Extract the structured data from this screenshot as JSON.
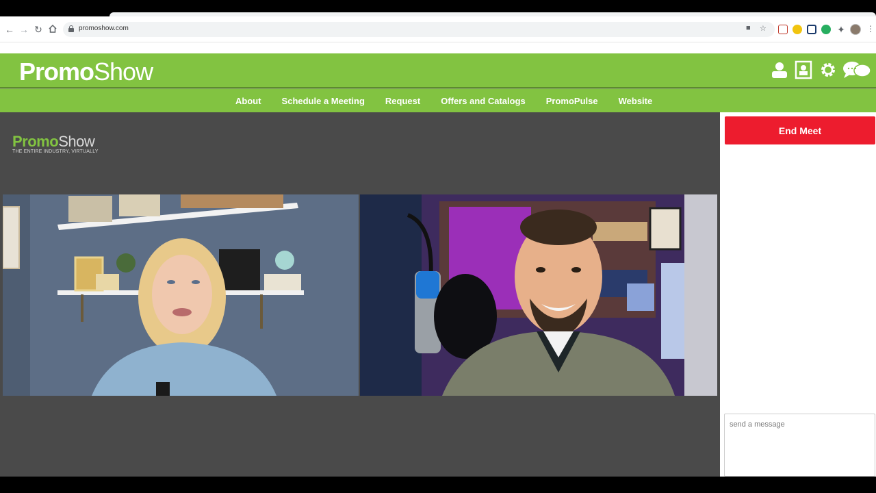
{
  "browser": {
    "url": "promoshow.com",
    "icons": [
      "back-icon",
      "forward-icon",
      "reload-icon",
      "home-icon",
      "lock-icon",
      "camera-icon",
      "star-icon",
      "puzzle-icon",
      "kebab-menu-icon"
    ]
  },
  "header": {
    "logo_bold": "Promo",
    "logo_light": "Show",
    "background": "#82c341",
    "icons": [
      "user-icon",
      "presenter-icon",
      "gear-icon",
      "chat-icon"
    ]
  },
  "nav": {
    "items": [
      {
        "label": "About"
      },
      {
        "label": "Schedule a Meeting"
      },
      {
        "label": "Request"
      },
      {
        "label": "Offers and Catalogs"
      },
      {
        "label": "PromoPulse"
      },
      {
        "label": "Website"
      }
    ]
  },
  "stage": {
    "watermark_bold": "Promo",
    "watermark_light": "Show",
    "watermark_tagline": "THE ENTIRE INDUSTRY, VIRTUALLY",
    "background": "#4a4a4a"
  },
  "sidebar": {
    "end_button_label": "End Meet",
    "end_button_color": "#ed1c2e",
    "message_placeholder": "send a message"
  }
}
